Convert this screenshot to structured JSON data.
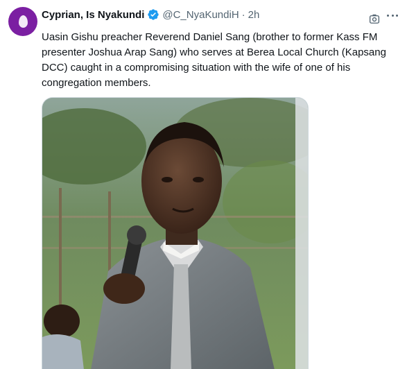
{
  "author": {
    "display_name": "Cyprian, Is Nyakundi",
    "handle": "@C_NyaKundiH",
    "separator": "·",
    "timestamp": "2h",
    "verified_color": "#1d9bf0",
    "avatar_color": "#7b1fa2"
  },
  "tweet": {
    "text": "Uasin Gishu preacher Reverend Daniel Sang (brother to former Kass FM presenter Joshua Arap Sang) who serves at Berea Local Church (Kapsang DCC) caught in a compromising situation with the wife of one of his congregation members."
  },
  "icons": {
    "avatar": "default-egg-avatar",
    "verified": "verified-badge-icon",
    "grok": "grok-icon",
    "more": "more-options-icon"
  },
  "media": {
    "description_kind": "photo"
  }
}
